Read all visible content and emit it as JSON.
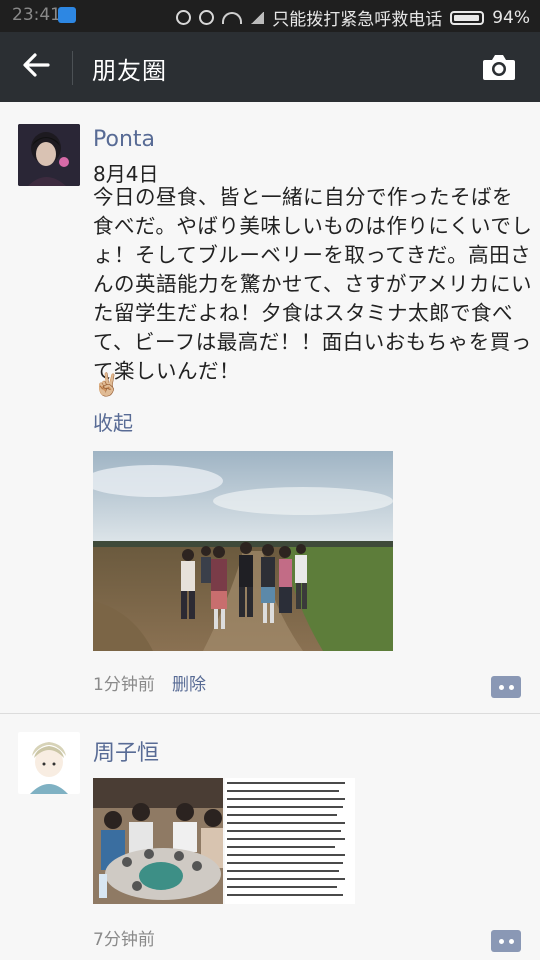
{
  "status_bar": {
    "time": "23:41",
    "carrier_text": "只能拨打紧急呼救电话",
    "battery": "94%"
  },
  "header": {
    "title": "朋友圈"
  },
  "posts": [
    {
      "username": "Ponta",
      "date": "8月4日",
      "text": "今日の昼食、皆と一緒に自分で作ったそばを食べだ。やばり美味しいものは作りにくいでしょ！そしてブルーベリーを取ってきだ。高田さんの英語能力を驚かせて、さすがアメリカにいた留学生だよね！夕食はスタミナ太郎で食べて、ビーフは最高だ！！面白いおもちゃを買って楽しいんだ！",
      "emoji": "✌🏼",
      "collapse_label": "收起",
      "time": "1分钟前",
      "delete_label": "删除"
    },
    {
      "username": "周子恒",
      "time": "7分钟前"
    }
  ],
  "colors": {
    "link": "#586b95",
    "header_bg": "#2b2f33",
    "status_bg": "#1f1f1f"
  }
}
